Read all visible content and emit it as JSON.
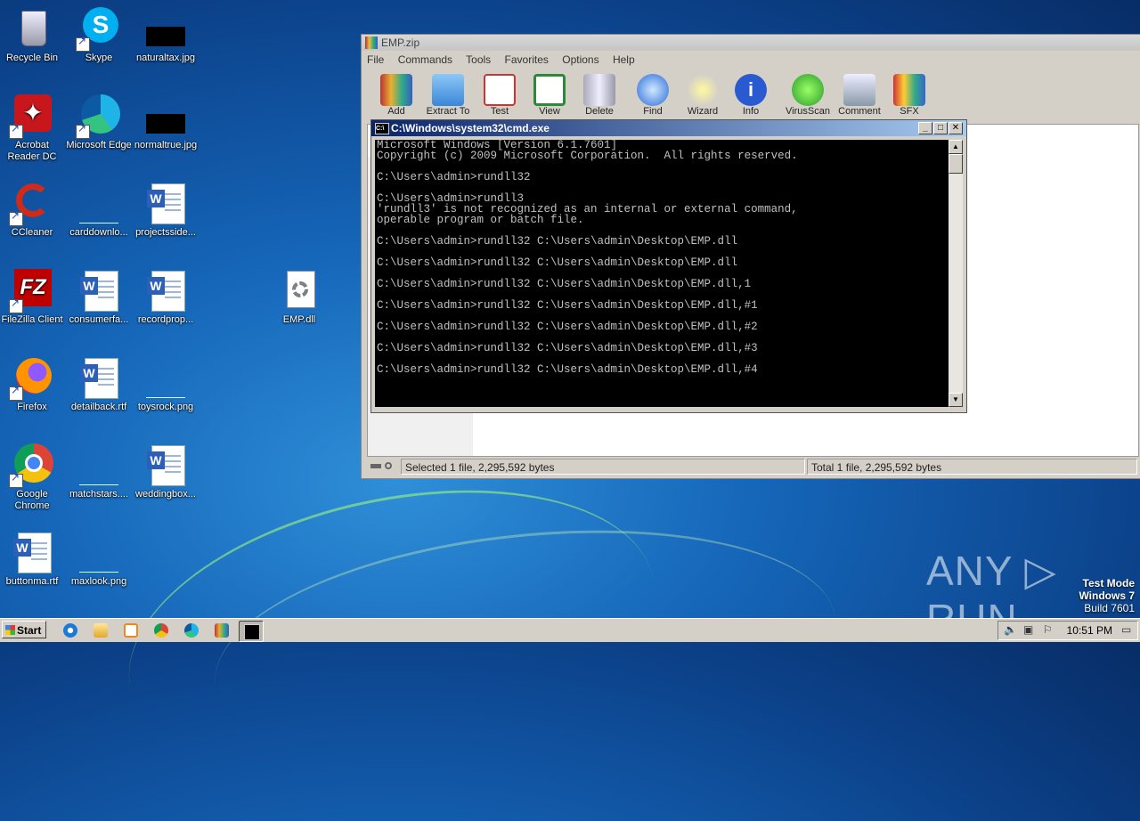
{
  "desktop": {
    "icons": [
      {
        "label": "Recycle Bin",
        "icon": "recycle-bin-icon"
      },
      {
        "label": "Skype",
        "icon": "skype-icon"
      },
      {
        "label": "naturaltax.jpg",
        "icon": "image-file-icon"
      },
      {
        "label": "Acrobat Reader DC",
        "icon": "acrobat-icon"
      },
      {
        "label": "Microsoft Edge",
        "icon": "edge-icon"
      },
      {
        "label": "normaltrue.jpg",
        "icon": "image-file-icon"
      },
      {
        "label": "CCleaner",
        "icon": "ccleaner-icon"
      },
      {
        "label": "carddownlo...",
        "icon": "image-file-icon"
      },
      {
        "label": "projectsside...",
        "icon": "word-doc-icon"
      },
      {
        "label": "FileZilla Client",
        "icon": "filezilla-icon"
      },
      {
        "label": "consumerfa...",
        "icon": "word-doc-icon"
      },
      {
        "label": "recordprop...",
        "icon": "word-doc-icon"
      },
      {
        "label": "EMP.dll",
        "icon": "dll-file-icon"
      },
      {
        "label": "Firefox",
        "icon": "firefox-icon"
      },
      {
        "label": "detailback.rtf",
        "icon": "word-doc-icon"
      },
      {
        "label": "toysrock.png",
        "icon": "image-file-icon"
      },
      {
        "label": "Google Chrome",
        "icon": "chrome-icon"
      },
      {
        "label": "matchstars....",
        "icon": "image-file-icon"
      },
      {
        "label": "weddingbox...",
        "icon": "word-doc-icon"
      },
      {
        "label": "buttonma.rtf",
        "icon": "word-doc-icon"
      },
      {
        "label": "maxlook.png",
        "icon": "image-file-icon"
      }
    ]
  },
  "winrar": {
    "title": "EMP.zip",
    "menu": [
      "File",
      "Commands",
      "Tools",
      "Favorites",
      "Options",
      "Help"
    ],
    "toolbar": [
      "Add",
      "Extract To",
      "Test",
      "View",
      "Delete",
      "Find",
      "Wizard",
      "Info",
      "VirusScan",
      "Comment",
      "SFX"
    ],
    "status_left": "Selected 1 file, 2,295,592 bytes",
    "status_right": "Total 1 file, 2,295,592 bytes"
  },
  "cmd": {
    "title": "C:\\Windows\\system32\\cmd.exe",
    "lines": [
      "Microsoft Windows [Version 6.1.7601]",
      "Copyright (c) 2009 Microsoft Corporation.  All rights reserved.",
      "",
      "C:\\Users\\admin>rundll32",
      "",
      "C:\\Users\\admin>rundll3",
      "'rundll3' is not recognized as an internal or external command,",
      "operable program or batch file.",
      "",
      "C:\\Users\\admin>rundll32 C:\\Users\\admin\\Desktop\\EMP.dll",
      "",
      "C:\\Users\\admin>rundll32 C:\\Users\\admin\\Desktop\\EMP.dll",
      "",
      "C:\\Users\\admin>rundll32 C:\\Users\\admin\\Desktop\\EMP.dll,1",
      "",
      "C:\\Users\\admin>rundll32 C:\\Users\\admin\\Desktop\\EMP.dll,#1",
      "",
      "C:\\Users\\admin>rundll32 C:\\Users\\admin\\Desktop\\EMP.dll,#2",
      "",
      "C:\\Users\\admin>rundll32 C:\\Users\\admin\\Desktop\\EMP.dll,#3",
      "",
      "C:\\Users\\admin>rundll32 C:\\Users\\admin\\Desktop\\EMP.dll,#4"
    ]
  },
  "watermark": {
    "brand": "ANY ▷ RUN",
    "mode": "Test Mode",
    "os": "Windows 7",
    "build": "Build 7601"
  },
  "taskbar": {
    "start_label": "Start",
    "clock": "10:51 PM",
    "quick_launch": [
      "ie-icon",
      "explorer-icon",
      "media-player-icon",
      "chrome-icon",
      "edge-icon"
    ],
    "tasks": [
      "winrar-icon",
      "cmd-icon"
    ]
  }
}
